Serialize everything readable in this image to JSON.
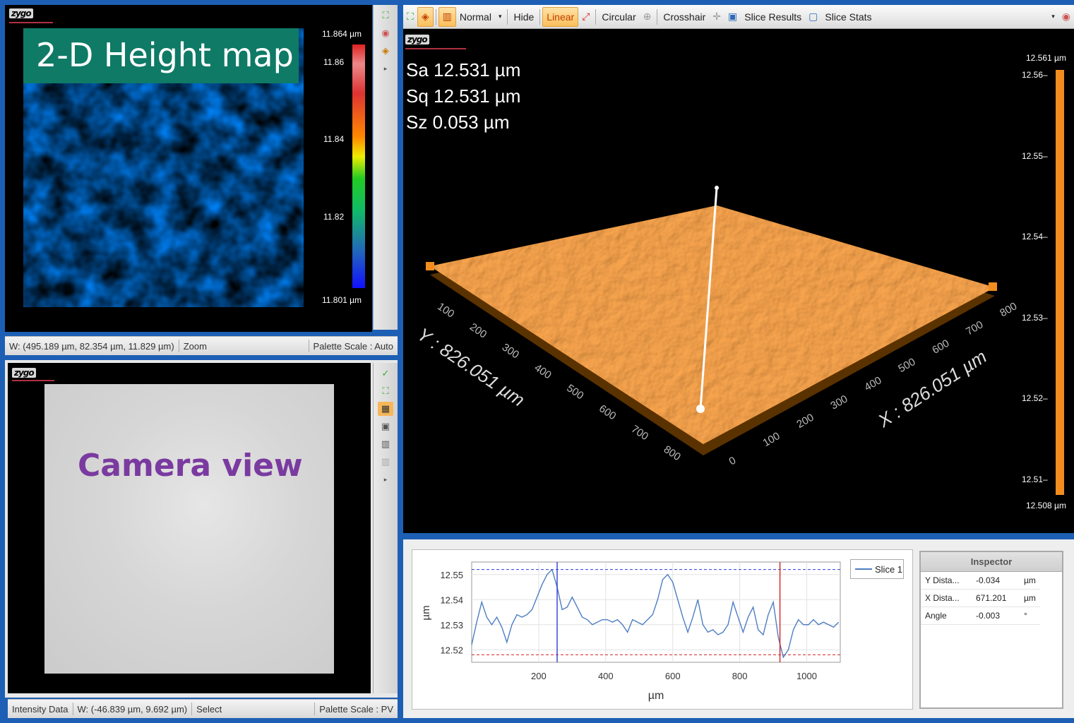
{
  "brand": "zygo",
  "height_map": {
    "title": "2-D Height map",
    "scale_top": "11.864 µm",
    "scale_bottom": "11.801 µm",
    "ticks": [
      "11.86",
      "11.84",
      "11.82"
    ],
    "status": {
      "coords": "W: (495.189 µm, 82.354 µm, 11.829 µm)",
      "mode": "Zoom",
      "palette": "Palette Scale : Auto"
    }
  },
  "camera_view": {
    "title": "Camera view",
    "status": {
      "source": "Intensity Data",
      "coords": "W: (-46.839 µm, 9.692 µm)",
      "mode": "Select",
      "palette": "Palette Scale : PV"
    }
  },
  "toolbar": {
    "normal": "Normal",
    "hide": "Hide",
    "linear": "Linear",
    "circular": "Circular",
    "crosshair": "Crosshair",
    "slice_results": "Slice Results",
    "slice_stats": "Slice Stats"
  },
  "view3d": {
    "stats": [
      {
        "label": "Sa",
        "value": "12.531",
        "unit": "µm"
      },
      {
        "label": "Sq",
        "value": "12.531",
        "unit": "µm"
      },
      {
        "label": "Sz",
        "value": "0.053",
        "unit": "µm"
      }
    ],
    "scale_top": "12.561 µm",
    "scale_bottom": "12.508 µm",
    "ticks": [
      "12.56",
      "12.55",
      "12.54",
      "12.53",
      "12.52",
      "12.51"
    ],
    "x_axis_label": "X : 826.051 µm",
    "y_axis_label": "Y : 826.051 µm",
    "x_ticks": [
      "0",
      "100",
      "200",
      "300",
      "400",
      "500",
      "600",
      "700",
      "800"
    ],
    "y_ticks": [
      "100",
      "200",
      "300",
      "400",
      "500",
      "600",
      "700",
      "800"
    ],
    "surface_color": "#f28c1e"
  },
  "chart_data": {
    "type": "line",
    "title": "",
    "xlabel": "µm",
    "ylabel": "µm",
    "xlim": [
      0,
      1100
    ],
    "ylim": [
      12.515,
      12.555
    ],
    "xticks": [
      200,
      400,
      600,
      800,
      1000
    ],
    "yticks": [
      12.52,
      12.53,
      12.54,
      12.55
    ],
    "series": [
      {
        "name": "Slice 1",
        "color": "#4d7ec2",
        "x": [
          0,
          15,
          30,
          45,
          60,
          75,
          90,
          105,
          120,
          135,
          150,
          165,
          180,
          195,
          210,
          225,
          240,
          255,
          270,
          285,
          300,
          315,
          330,
          345,
          360,
          375,
          390,
          405,
          420,
          435,
          450,
          465,
          480,
          495,
          510,
          525,
          540,
          555,
          570,
          585,
          600,
          615,
          630,
          645,
          660,
          675,
          690,
          705,
          720,
          735,
          750,
          765,
          780,
          795,
          810,
          825,
          840,
          855,
          870,
          885,
          900,
          915,
          930,
          945,
          960,
          975,
          990,
          1005,
          1020,
          1035,
          1050,
          1065,
          1080,
          1095
        ],
        "y": [
          12.522,
          12.531,
          12.539,
          12.533,
          12.53,
          12.533,
          12.529,
          12.523,
          12.53,
          12.534,
          12.533,
          12.534,
          12.536,
          12.541,
          12.546,
          12.55,
          12.552,
          12.545,
          12.536,
          12.537,
          12.541,
          12.537,
          12.533,
          12.532,
          12.53,
          12.531,
          12.532,
          12.532,
          12.531,
          12.532,
          12.53,
          12.527,
          12.532,
          12.531,
          12.53,
          12.532,
          12.534,
          12.54,
          12.548,
          12.55,
          12.547,
          12.54,
          12.533,
          12.527,
          12.533,
          12.54,
          12.53,
          12.527,
          12.528,
          12.526,
          12.527,
          12.53,
          12.539,
          12.533,
          12.527,
          12.533,
          12.537,
          12.528,
          12.526,
          12.534,
          12.539,
          12.525,
          12.517,
          12.52,
          12.528,
          12.532,
          12.53,
          12.53,
          12.532,
          12.53,
          12.531,
          12.53,
          12.529,
          12.531
        ]
      }
    ],
    "cursors": [
      {
        "x": 255,
        "color": "#2f3dd8"
      },
      {
        "x": 920,
        "color": "#d22222"
      }
    ],
    "ref_lines": [
      {
        "y": 12.552,
        "color": "#2f3dd8"
      },
      {
        "y": 12.518,
        "color": "#d22222"
      }
    ],
    "legend": "top-right",
    "grid": true
  },
  "inspector": {
    "title": "Inspector",
    "rows": [
      {
        "label": "Y Dista...",
        "value": "-0.034",
        "unit": "µm"
      },
      {
        "label": "X Dista...",
        "value": "671.201",
        "unit": "µm"
      },
      {
        "label": "Angle",
        "value": "-0.003",
        "unit": "°"
      }
    ]
  }
}
